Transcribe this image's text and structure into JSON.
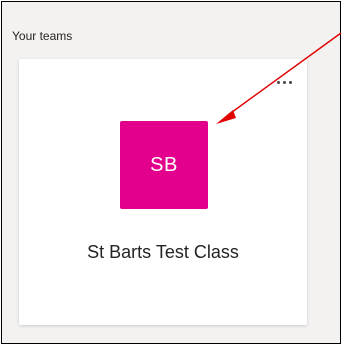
{
  "section": {
    "title": "Your teams"
  },
  "team": {
    "initials": "SB",
    "name": "St Barts Test Class",
    "avatar_color": "#e3008c",
    "more_options_icon": "more-horizontal-icon"
  },
  "annotation": {
    "arrow_color": "#e00000"
  }
}
